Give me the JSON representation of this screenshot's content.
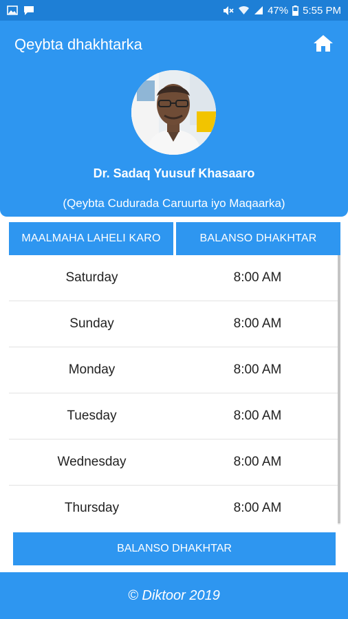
{
  "status_bar": {
    "battery": "47%",
    "time": "5:55 PM",
    "icons": [
      "image-icon",
      "message-icon",
      "mute-icon",
      "wifi-icon",
      "signal-icon",
      "battery-icon"
    ]
  },
  "header": {
    "title": "Qeybta dhakhtarka",
    "home_icon": "home-icon",
    "doctor_name": "Dr.  Sadaq Yuusuf Khasaaro",
    "department": "(Qeybta  Cudurada Caruurta iyo Maqaarka)"
  },
  "table": {
    "columns": [
      "MAALMAHA LAHELI KARO",
      "BALANSO DHAKHTAR"
    ],
    "rows": [
      {
        "day": "Saturday",
        "time": "8:00 AM"
      },
      {
        "day": "Sunday",
        "time": "8:00 AM"
      },
      {
        "day": "Monday",
        "time": "8:00 AM"
      },
      {
        "day": "Tuesday",
        "time": "8:00 AM"
      },
      {
        "day": "Wednesday",
        "time": "8:00 AM"
      },
      {
        "day": "Thursday",
        "time": "8:00 AM"
      }
    ]
  },
  "book_button": {
    "label": "BALANSO DHAKHTAR"
  },
  "footer": {
    "text": "© Diktoor 2019"
  },
  "colors": {
    "primary": "#2e96f0",
    "status_bar": "#1e7fd6",
    "text": "#222222"
  }
}
